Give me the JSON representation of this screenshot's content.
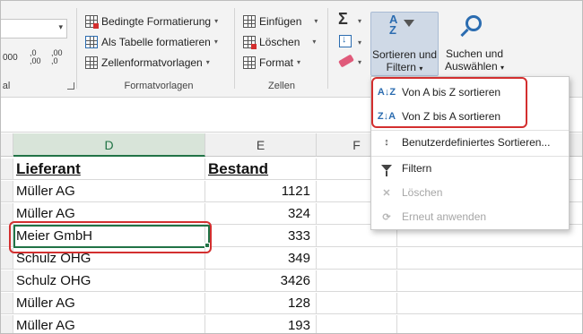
{
  "ribbon": {
    "number_glyph_left": "000",
    "inc_decimal": ",0 ,00",
    "dec_decimal": ",00 ,0",
    "group_number_label": "al",
    "styles": {
      "conditional": "Bedingte Formatierung",
      "as_table": "Als Tabelle formatieren",
      "cell_styles": "Zellenformatvorlagen",
      "group_label": "Formatvorlagen"
    },
    "cells": {
      "insert": "Einfügen",
      "delete": "Löschen",
      "format": "Format",
      "group_label": "Zellen"
    },
    "editing": {
      "sum_symbol": "Σ",
      "sort_filter_line1": "Sortieren und",
      "sort_filter_line2": "Filtern",
      "find_select_line1": "Suchen und",
      "find_select_line2": "Auswählen"
    }
  },
  "columns": [
    "D",
    "E",
    "F"
  ],
  "table": {
    "headers": [
      "Lieferant",
      "Bestand"
    ],
    "rows": [
      [
        "Müller AG",
        "1121"
      ],
      [
        "Müller AG",
        "324"
      ],
      [
        "Meier GmbH",
        "333"
      ],
      [
        "Schulz OHG",
        "349"
      ],
      [
        "Schulz OHG",
        "3426"
      ],
      [
        "Müller AG",
        "128"
      ],
      [
        "Müller AG",
        "193"
      ]
    ]
  },
  "menu": {
    "items": [
      {
        "icon": "A↓Z",
        "label": "Von A bis Z sortieren",
        "disabled": false
      },
      {
        "icon": "Z↓A",
        "label": "Von Z bis A sortieren",
        "disabled": false
      },
      {
        "icon": "↕",
        "label": "Benutzerdefiniertes Sortieren...",
        "disabled": false
      },
      {
        "icon": "funnel",
        "label": "Filtern",
        "disabled": false
      },
      {
        "icon": "clear-filter",
        "label": "Löschen",
        "disabled": true
      },
      {
        "icon": "reapply",
        "label": "Erneut anwenden",
        "disabled": true
      }
    ]
  },
  "colors": {
    "excel_green": "#217346",
    "highlight_red": "#d32f2f",
    "sort_button_active": "#cfd9e6"
  }
}
